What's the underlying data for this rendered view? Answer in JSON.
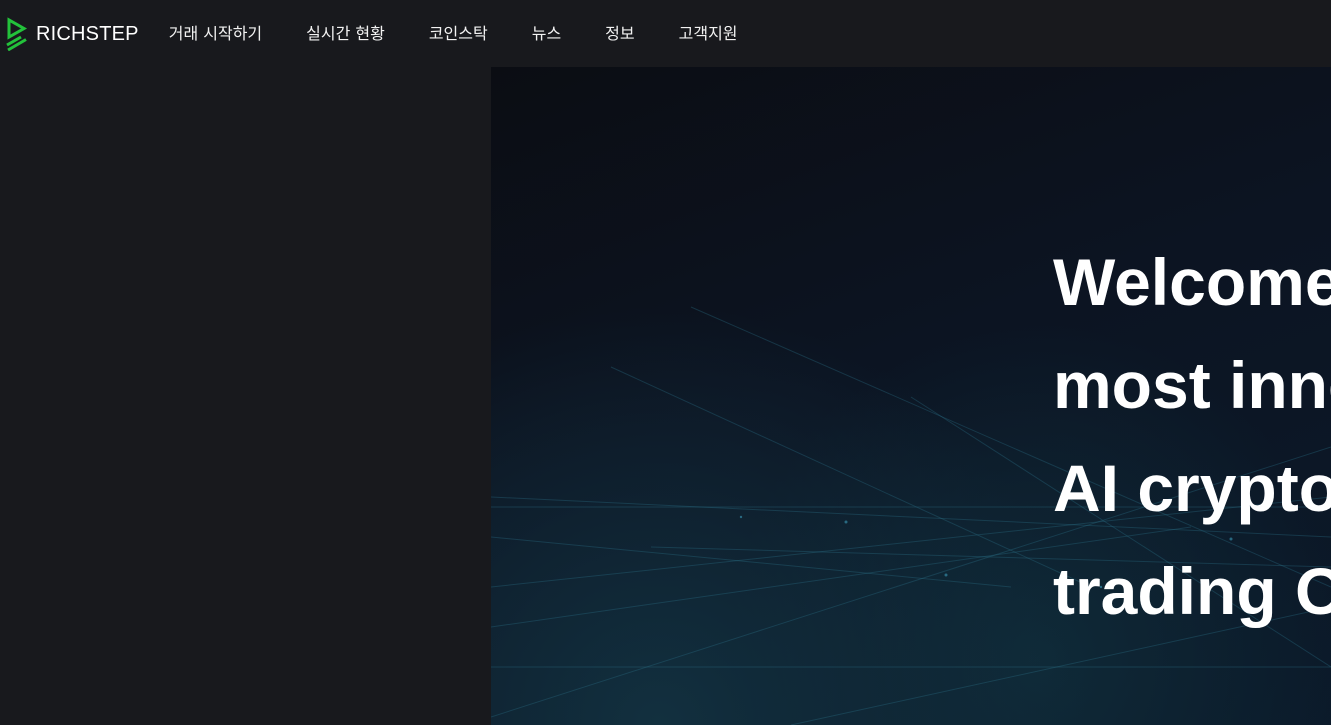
{
  "brand": {
    "name": "RICHSTEP",
    "logo_icon": "richstep-play-logo-icon",
    "accent_color": "#23c23b"
  },
  "nav": {
    "items": [
      {
        "label": "거래 시작하기"
      },
      {
        "label": "실시간 현황"
      },
      {
        "label": "코인스탁"
      },
      {
        "label": "뉴스"
      },
      {
        "label": "정보"
      },
      {
        "label": "고객지원"
      }
    ]
  },
  "hero": {
    "lines": [
      "Welcome",
      "most inno",
      "AI crypto",
      "trading O"
    ]
  },
  "colors": {
    "topbar_bg": "#18191d",
    "hero_text": "#ffffff"
  }
}
